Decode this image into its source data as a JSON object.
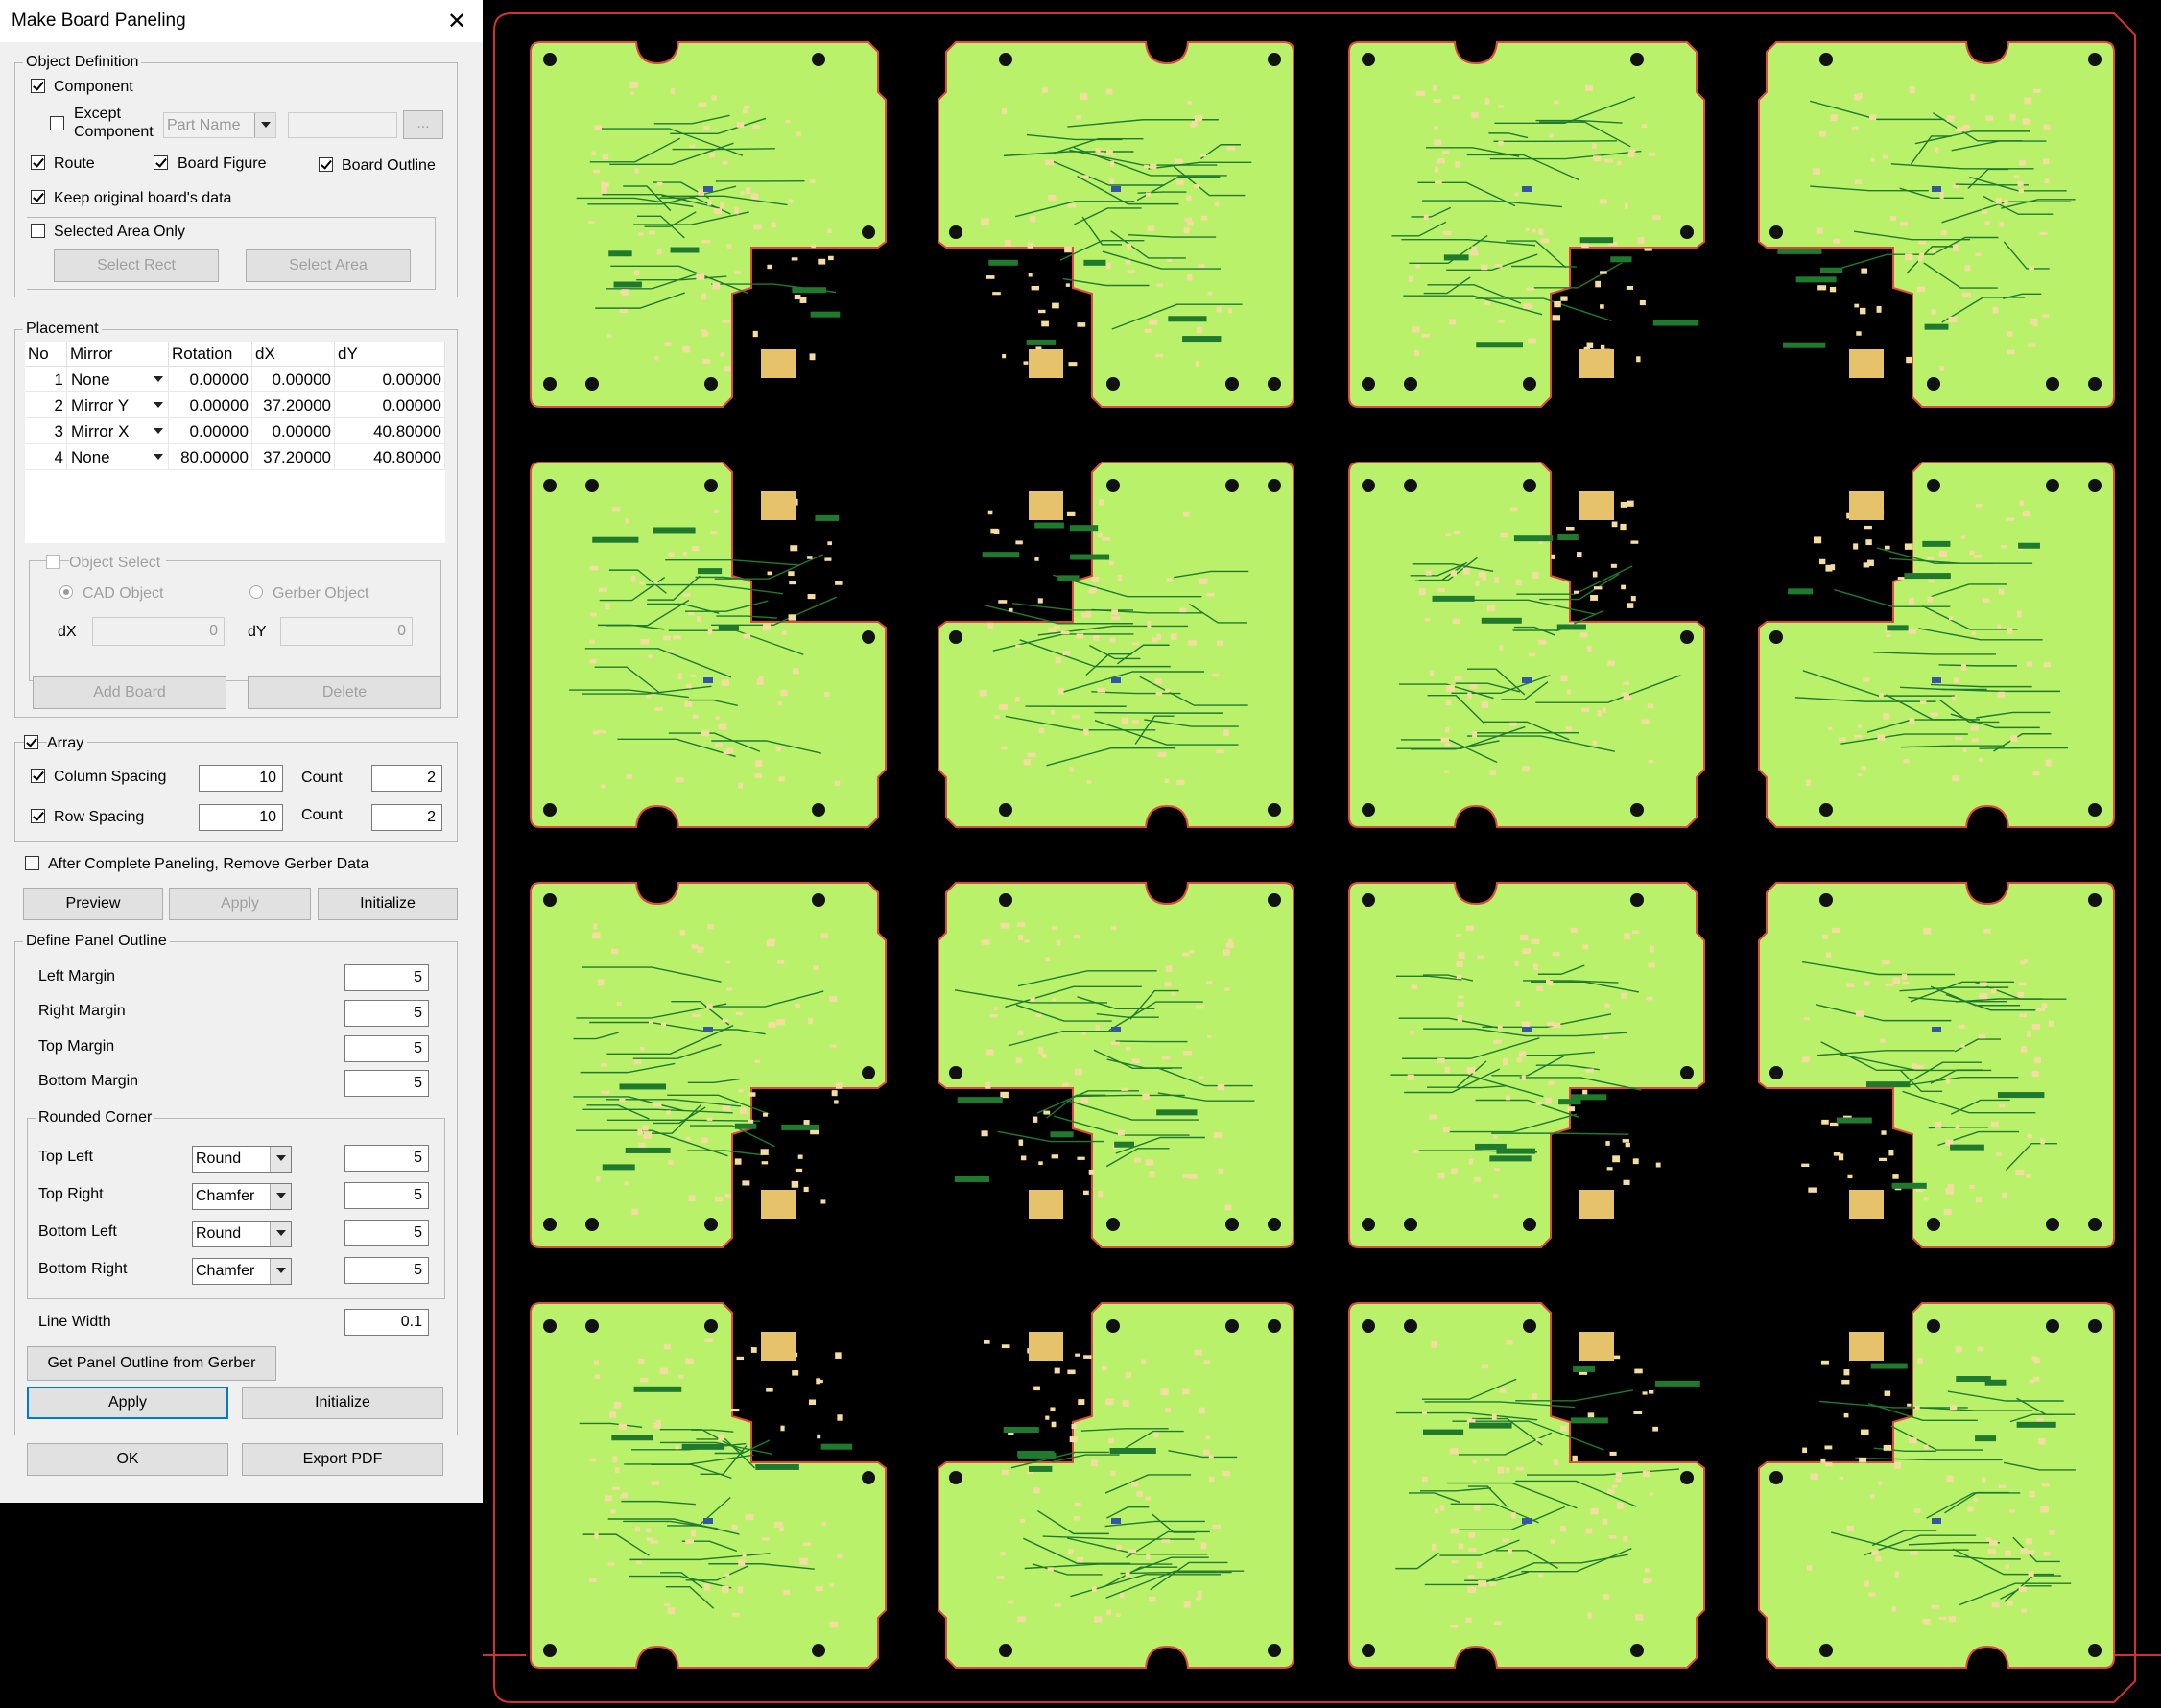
{
  "window": {
    "title": "Make Board Paneling"
  },
  "object_definition": {
    "legend": "Object Definition",
    "component": {
      "label": "Component",
      "checked": true
    },
    "except_component": {
      "label_line1": "Except",
      "label_line2": "Component",
      "checked": false,
      "combo_value": "Part Name",
      "text_value": "",
      "browse_label": "..."
    },
    "route": {
      "label": "Route",
      "checked": true
    },
    "board_figure": {
      "label": "Board Figure",
      "checked": true
    },
    "board_outline": {
      "label": "Board Outline",
      "checked": true
    },
    "keep_original": {
      "label": "Keep original board's data",
      "checked": true
    },
    "selected_area_only": {
      "label": "Selected Area Only",
      "checked": false
    },
    "select_rect_label": "Select Rect",
    "select_area_label": "Select Area"
  },
  "placement": {
    "legend": "Placement",
    "columns": [
      "No",
      "Mirror",
      "Rotation",
      "dX",
      "dY"
    ],
    "rows": [
      {
        "no": "1",
        "mirror": "None",
        "rotation": "0.00000",
        "dx": "0.00000",
        "dy": "0.00000"
      },
      {
        "no": "2",
        "mirror": "Mirror Y",
        "rotation": "0.00000",
        "dx": "37.20000",
        "dy": "0.00000"
      },
      {
        "no": "3",
        "mirror": "Mirror X",
        "rotation": "0.00000",
        "dx": "0.00000",
        "dy": "40.80000"
      },
      {
        "no": "4",
        "mirror": "None",
        "rotation": "80.00000",
        "dx": "37.20000",
        "dy": "40.80000"
      }
    ],
    "object_select": {
      "label": "Object Select",
      "checked": false,
      "cad_object": "CAD Object",
      "gerber_object": "Gerber Object",
      "dx_label": "dX",
      "dx_value": "0",
      "dy_label": "dY",
      "dy_value": "0"
    },
    "add_board_label": "Add Board",
    "delete_label": "Delete"
  },
  "array": {
    "label": "Array",
    "checked": true,
    "column_spacing": {
      "label": "Column Spacing",
      "checked": true,
      "value": "10",
      "count_label": "Count",
      "count": "2"
    },
    "row_spacing": {
      "label": "Row Spacing",
      "checked": true,
      "value": "10",
      "count_label": "Count",
      "count": "2"
    }
  },
  "remove_gerber": {
    "label": "After Complete Paneling, Remove Gerber Data",
    "checked": false
  },
  "actions": {
    "preview": "Preview",
    "apply": "Apply",
    "initialize": "Initialize"
  },
  "panel_outline": {
    "legend": "Define Panel Outline",
    "left_margin": {
      "label": "Left Margin",
      "value": "5"
    },
    "right_margin": {
      "label": "Right Margin",
      "value": "5"
    },
    "top_margin": {
      "label": "Top Margin",
      "value": "5"
    },
    "bottom_margin": {
      "label": "Bottom Margin",
      "value": "5"
    },
    "rounded_corner": {
      "legend": "Rounded Corner",
      "top_left": {
        "label": "Top Left",
        "type": "Round",
        "value": "5"
      },
      "top_right": {
        "label": "Top Right",
        "type": "Chamfer",
        "value": "5"
      },
      "bottom_left": {
        "label": "Bottom Left",
        "type": "Round",
        "value": "5"
      },
      "bottom_right": {
        "label": "Bottom Right",
        "type": "Chamfer",
        "value": "5"
      }
    },
    "line_width": {
      "label": "Line Width",
      "value": "0.1"
    },
    "get_outline_label": "Get Panel Outline from Gerber",
    "apply_label": "Apply",
    "initialize_label": "Initialize"
  },
  "footer": {
    "ok": "OK",
    "export_pdf": "Export PDF"
  },
  "colors": {
    "board": "#b9f26a",
    "board_outline": "#e04a3a",
    "panel_outline": "#d43030",
    "background": "#000000",
    "trace": "#1f7a2e",
    "pad": "#f5dca0"
  }
}
